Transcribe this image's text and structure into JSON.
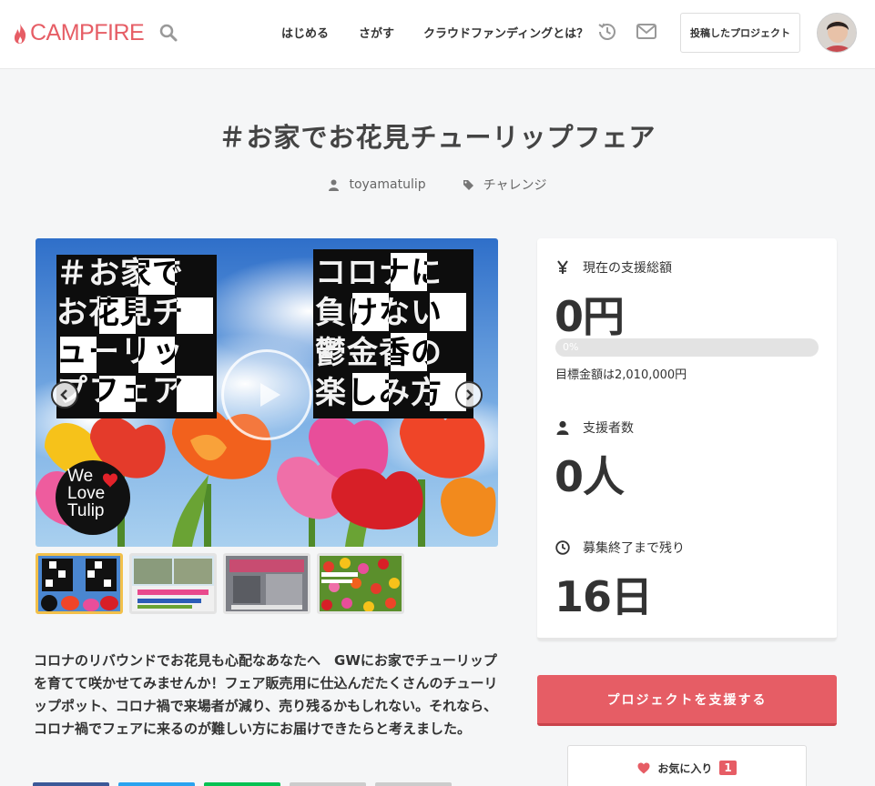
{
  "header": {
    "logo_text": "CAMPFIRE",
    "nav": [
      "はじめる",
      "さがす",
      "クラウドファンディングとは？"
    ],
    "posted_projects_label": "投稿したプロジェクト"
  },
  "project": {
    "title": "＃お家でお花見チューリップフェア",
    "owner": "toyamatulip",
    "category": "チャレンジ",
    "image_text": {
      "left_lines": [
        "＃お家で",
        "お花見チ",
        "ューリッ",
        "プフェア"
      ],
      "right_lines": [
        "コロナに",
        "負けない",
        "鬱金香の",
        "楽しみ方"
      ],
      "badge_lines": [
        "We",
        "Love",
        "Tulip"
      ]
    },
    "thumbnail_count": 4,
    "description": "コロナのリバウンドでお花見も心配なあなたへ　GWにお家でチューリップを育てて咲かせてみませんか！フェア販売用に仕込んだたくさんのチューリップポット、コロナ禍で来場者が減り、売り残るかもしれない。それなら、コロナ禍でフェアに来るのが難しい方にお届けできたらと考えました。"
  },
  "stats": {
    "total_label": "現在の支援総額",
    "total_value": "0円",
    "progress_text": "0%",
    "progress_percent": 0,
    "goal_text": "目標金額は2,010,000円",
    "supporters_label": "支援者数",
    "supporters_value": "0人",
    "remaining_label": "募集終了まで残り",
    "remaining_value": "16日"
  },
  "actions": {
    "support_label": "プロジェクトを支援する",
    "favorite_label": "お気に入り",
    "favorite_count": "1"
  },
  "colors": {
    "brand": "#e65d65",
    "active_thumb": "#f2c04a"
  }
}
